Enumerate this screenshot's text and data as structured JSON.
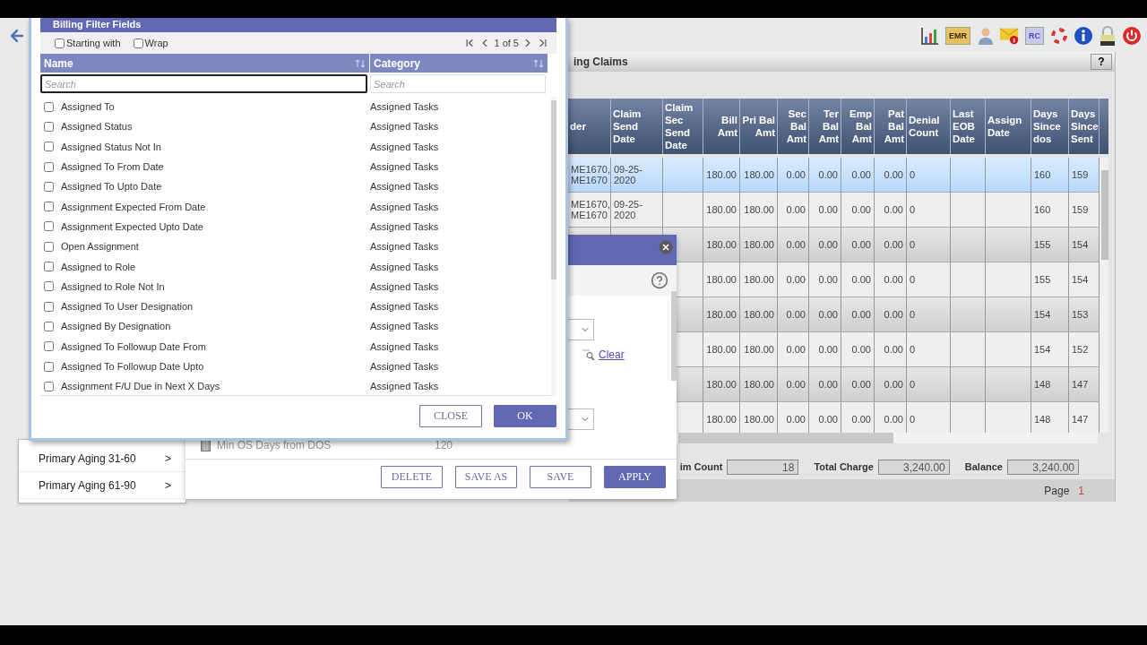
{
  "toolbar": {
    "emr_label": "EMR",
    "rc_label": "RC"
  },
  "claims_panel": {
    "title": "ing Claims",
    "help_button": "?",
    "table": {
      "columns": [
        "der",
        "Claim Send Date",
        "Claim Sec Send Date",
        "Bill Amt",
        "Pri Bal Amt",
        "Sec Bal Amt",
        "Ter Bal Amt",
        "Emp Bal Amt",
        "Pat Bal Amt",
        "Denial Count",
        "Last EOB Date",
        "Assign Date",
        "Days Since dos",
        "Days Since Sent"
      ],
      "rows": [
        {
          "selected": true,
          "cells": [
            "ME1670, ME1670",
            "09-25-2020",
            null,
            "180.00",
            "180.00",
            "0.00",
            "0.00",
            "0.00",
            "0.00",
            "0",
            null,
            null,
            "160",
            "159"
          ]
        },
        {
          "selected": false,
          "cells": [
            "ME1670, ME1670",
            "09-25-2020",
            null,
            "180.00",
            "180.00",
            "0.00",
            "0.00",
            "0.00",
            "0.00",
            "0",
            null,
            null,
            "160",
            "159"
          ]
        },
        {
          "selected": false,
          "cells": [
            null,
            null,
            null,
            "180.00",
            "180.00",
            "0.00",
            "0.00",
            "0.00",
            "0.00",
            "0",
            null,
            null,
            "155",
            "154"
          ]
        },
        {
          "selected": false,
          "cells": [
            null,
            null,
            null,
            "180.00",
            "180.00",
            "0.00",
            "0.00",
            "0.00",
            "0.00",
            "0",
            null,
            null,
            "155",
            "154"
          ]
        },
        {
          "selected": false,
          "cells": [
            null,
            null,
            null,
            "180.00",
            "180.00",
            "0.00",
            "0.00",
            "0.00",
            "0.00",
            "0",
            null,
            null,
            "154",
            "153"
          ]
        },
        {
          "selected": false,
          "cells": [
            null,
            null,
            null,
            "180.00",
            "180.00",
            "0.00",
            "0.00",
            "0.00",
            "0.00",
            "0",
            null,
            null,
            "154",
            "152"
          ]
        },
        {
          "selected": false,
          "cells": [
            null,
            null,
            null,
            "180.00",
            "180.00",
            "0.00",
            "0.00",
            "0.00",
            "0.00",
            "0",
            null,
            null,
            "148",
            "147"
          ]
        },
        {
          "selected": false,
          "cells": [
            null,
            null,
            null,
            "180.00",
            "180.00",
            "0.00",
            "0.00",
            "0.00",
            "0.00",
            "0",
            null,
            null,
            "148",
            "147"
          ]
        }
      ]
    },
    "summary": [
      {
        "label": "im Count",
        "value": "18"
      },
      {
        "label": "Total Charge",
        "value": "3,240.00"
      },
      {
        "label": "Balance",
        "value": "3,240.00"
      }
    ],
    "page_label": "Page",
    "page": "1"
  },
  "sidebar": {
    "items": [
      {
        "label": "Primary Aging 31-60",
        "arrow": ">"
      },
      {
        "label": "Primary Aging 61-90",
        "arrow": ">"
      }
    ]
  },
  "filter_dialog": {
    "clear_link": "Clear",
    "criteria": [
      {
        "name": "Min OS Days from DOS",
        "value": "120"
      }
    ],
    "buttons": [
      {
        "label": "DELETE",
        "kind": "secondary"
      },
      {
        "label": "SAVE AS",
        "kind": "secondary"
      },
      {
        "label": "SAVE",
        "kind": "secondary"
      },
      {
        "label": "APPLY",
        "kind": "primary"
      }
    ]
  },
  "dialog": {
    "title": "Billing Filter Fields",
    "options": [
      {
        "label": "Starting with",
        "checked": false
      },
      {
        "label": "Wrap",
        "checked": false
      }
    ],
    "pager": "1 of 5",
    "columns": [
      {
        "label": "Name",
        "placeholder": "Search"
      },
      {
        "label": "Category",
        "placeholder": "Search"
      }
    ],
    "rows": [
      {
        "name": "Assigned To",
        "category": "Assigned Tasks",
        "checked": false
      },
      {
        "name": "Assigned Status",
        "category": "Assigned Tasks",
        "checked": false
      },
      {
        "name": "Assigned Status Not In",
        "category": "Assigned Tasks",
        "checked": false
      },
      {
        "name": "Assigned To From Date",
        "category": "Assigned Tasks",
        "checked": false
      },
      {
        "name": "Assigned To Upto Date",
        "category": "Assigned Tasks",
        "checked": false
      },
      {
        "name": "Assignment Expected From Date",
        "category": "Assigned Tasks",
        "checked": false
      },
      {
        "name": "Assignment Expected Upto Date",
        "category": "Assigned Tasks",
        "checked": false
      },
      {
        "name": "Open Assignment",
        "category": "Assigned Tasks",
        "checked": false
      },
      {
        "name": "Assigned to Role",
        "category": "Assigned Tasks",
        "checked": false
      },
      {
        "name": "Assigned to Role Not In",
        "category": "Assigned Tasks",
        "checked": false
      },
      {
        "name": "Assigned To User Designation",
        "category": "Assigned Tasks",
        "checked": false
      },
      {
        "name": "Assigned By Designation",
        "category": "Assigned Tasks",
        "checked": false
      },
      {
        "name": "Assigned To Followup Date From",
        "category": "Assigned Tasks",
        "checked": false
      },
      {
        "name": "Assigned To Followup Date Upto",
        "category": "Assigned Tasks",
        "checked": false
      },
      {
        "name": "Assignment F/U Due in Next X Days",
        "category": "Assigned Tasks",
        "checked": false
      }
    ],
    "buttons": [
      {
        "label": "CLOSE",
        "kind": "secondary"
      },
      {
        "label": "OK",
        "kind": "primary"
      }
    ]
  }
}
